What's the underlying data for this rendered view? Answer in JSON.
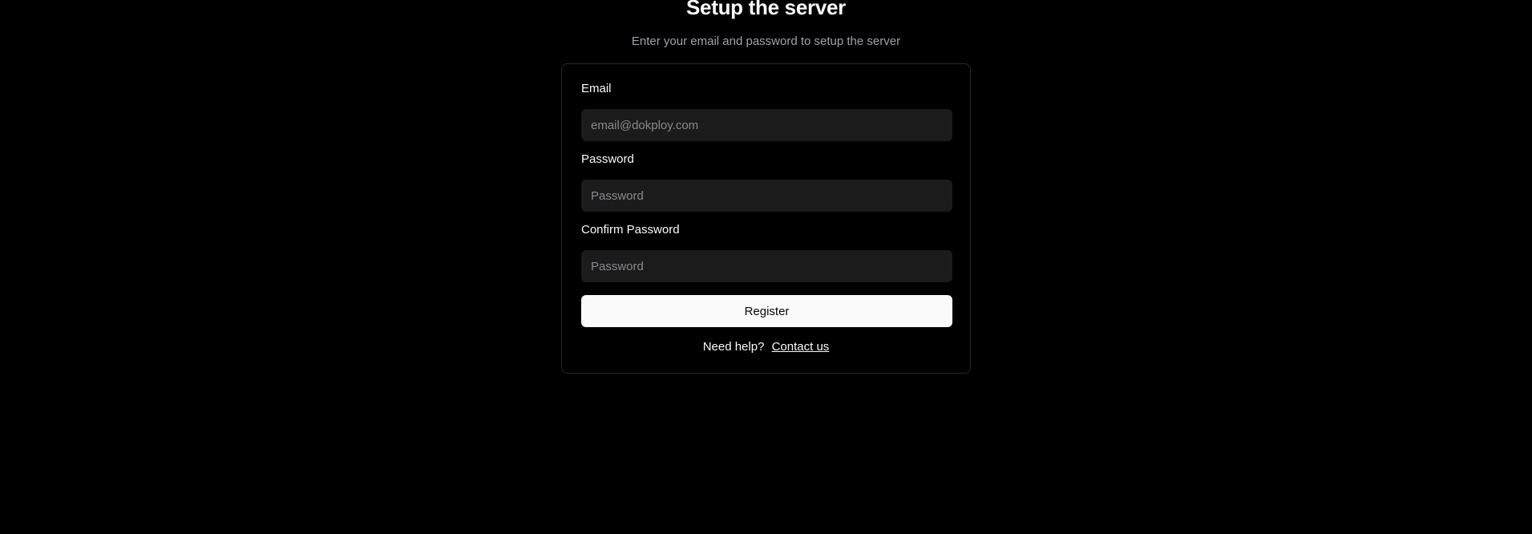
{
  "header": {
    "title": "Setup the server",
    "subtitle": "Enter your email and password to setup the server"
  },
  "form": {
    "email": {
      "label": "Email",
      "placeholder": "email@dokploy.com",
      "value": ""
    },
    "password": {
      "label": "Password",
      "placeholder": "Password",
      "value": ""
    },
    "confirm_password": {
      "label": "Confirm Password",
      "placeholder": "Password",
      "value": ""
    },
    "submit_label": "Register"
  },
  "help": {
    "text": "Need help?",
    "link_label": "Contact us"
  },
  "colors": {
    "background": "#000000",
    "card_border": "#27272a",
    "input_background": "#1b1b1c",
    "button_background": "#fafafa",
    "button_text": "#09090b",
    "muted_text": "#a1a1aa"
  }
}
